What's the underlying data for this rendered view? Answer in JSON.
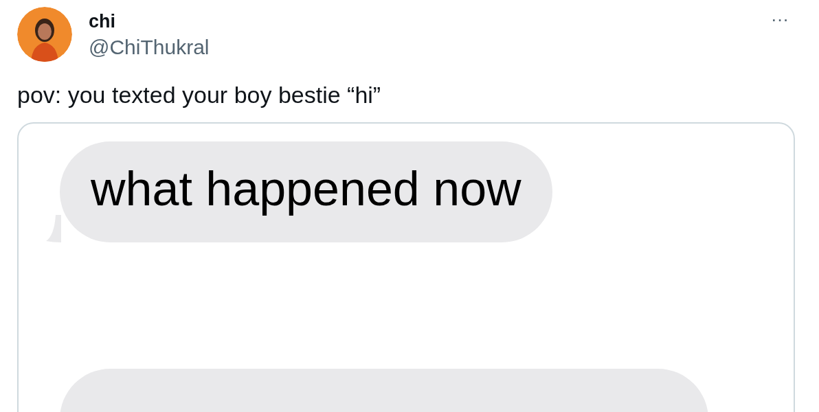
{
  "author": {
    "name": "chi",
    "handle": "@ChiThukral"
  },
  "menu": "···",
  "text": "pov: you texted your boy bestie “hi”",
  "messages": [
    {
      "kind": "text",
      "text": "what happened now"
    },
    {
      "kind": "cut"
    }
  ]
}
